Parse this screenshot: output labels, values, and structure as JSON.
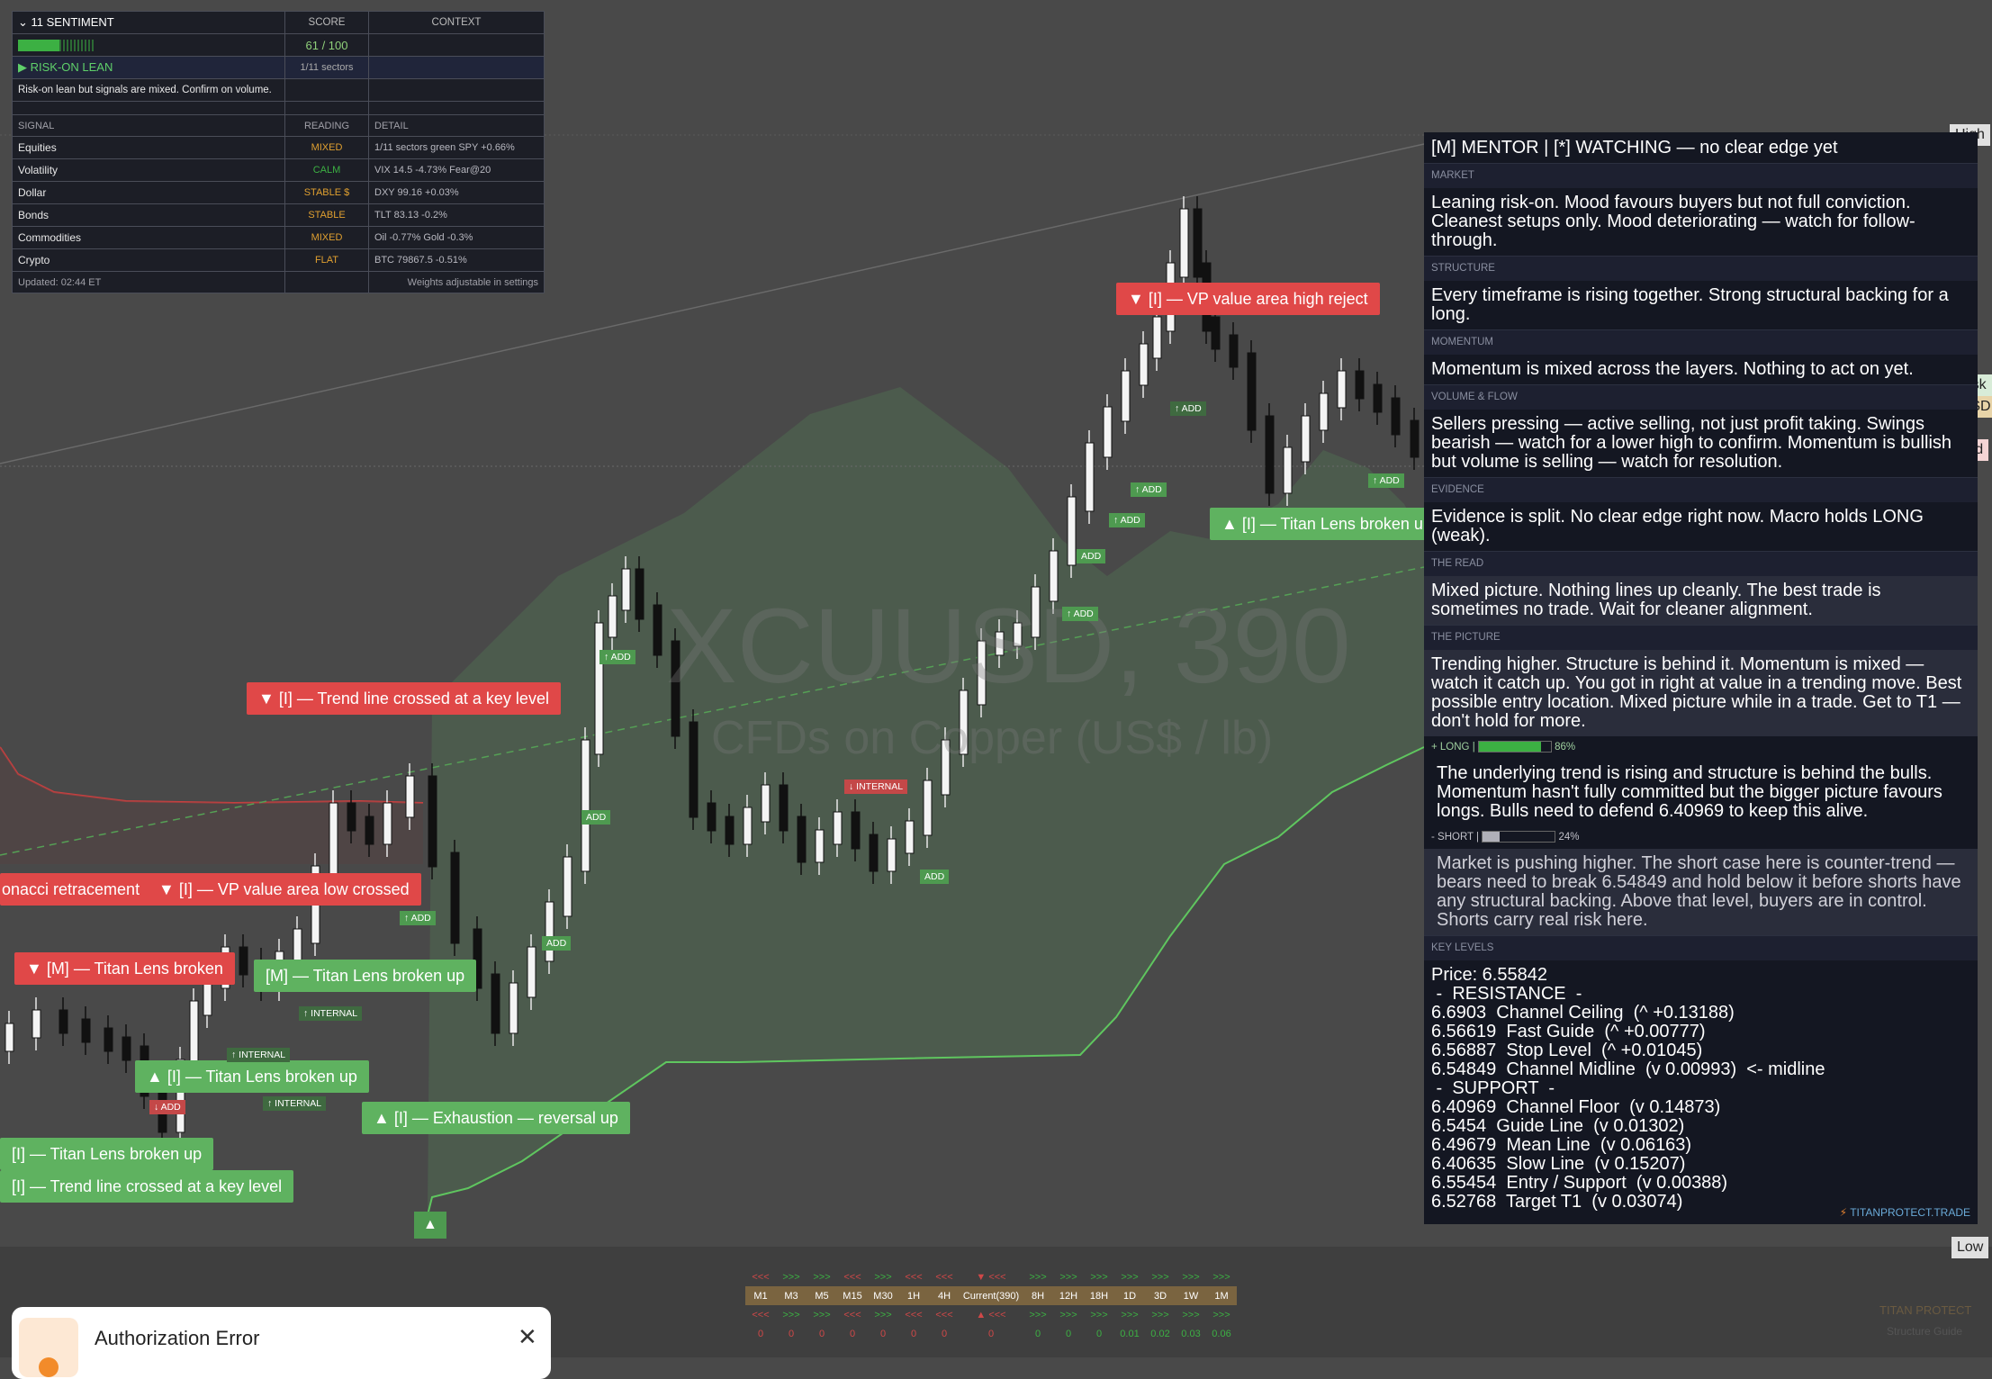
{
  "sentiment": {
    "badge": "11",
    "title": "SENTIMENT",
    "score_header": "SCORE",
    "context_header": "CONTEXT",
    "score": "61 / 100",
    "score_pct": 61,
    "lean": "▶ RISK-ON LEAN",
    "lean_sectors": "1/11 sectors",
    "note": "Risk-on lean but signals are mixed. Confirm on volume.",
    "signal_header": "SIGNAL",
    "reading_header": "READING",
    "detail_header": "DETAIL",
    "rows": [
      {
        "signal": "Equities",
        "reading": "MIXED",
        "detail": "1/11 sectors green  SPY +0.66%",
        "color": "#e0a030"
      },
      {
        "signal": "Volatility",
        "reading": "CALM",
        "detail": "VIX 14.5  -4.73%  Fear@20",
        "color": "#3cb043"
      },
      {
        "signal": "Dollar",
        "reading": "STABLE $",
        "detail": "DXY 99.16  +0.03%",
        "color": "#e0a030"
      },
      {
        "signal": "Bonds",
        "reading": "STABLE",
        "detail": "TLT 83.13  -0.2%",
        "color": "#e0a030"
      },
      {
        "signal": "Commodities",
        "reading": "MIXED",
        "detail": "Oil -0.77%  Gold -0.3%",
        "color": "#e0a030"
      },
      {
        "signal": "Crypto",
        "reading": "FLAT",
        "detail": "BTC 79867.5  -0.51%",
        "color": "#e0a030"
      }
    ],
    "updated": "Updated: 02:44 ET",
    "weights": "Weights adjustable in settings"
  },
  "mentor": {
    "title": "[M]  MENTOR  |  [*]  WATCHING  —  no clear edge yet",
    "market_label": "MARKET",
    "market": "Leaning risk-on. Mood favours buyers but not full conviction. Cleanest setups only. Mood deteriorating — watch for follow-through.",
    "structure_label": "STRUCTURE",
    "structure": "Every timeframe is rising together. Strong structural backing for a long.",
    "momentum_label": "MOMENTUM",
    "momentum": "Momentum is mixed across the layers. Nothing to act on yet.",
    "volume_label": "VOLUME & FLOW",
    "volume": "Sellers pressing — active selling, not just profit taking. Swings bearish — watch for a lower high to confirm. Momentum is bullish but volume is selling — watch for resolution.",
    "evidence_label": "EVIDENCE",
    "evidence": "Evidence is split. No clear edge right now. Macro holds LONG (weak).",
    "read_label": "THE READ",
    "read": "Mixed picture. Nothing lines up cleanly. The best trade is sometimes no trade. Wait for cleaner alignment.",
    "picture_label": "THE PICTURE",
    "picture": "Trending higher. Structure is behind it. Momentum is mixed — watch it catch up. You got in right at value in a trending move. Best possible entry location. Mixed picture while in a trade. Get to T1 — don't hold for more.",
    "long_label": "+ LONG  |",
    "long_pct": "86%",
    "long_value": 86,
    "long_text": "The underlying trend is rising and structure is behind the bulls. Momentum hasn't fully committed but the bigger picture favours longs. Bulls need to defend 6.40969 to keep this alive.",
    "short_label": "- SHORT  |",
    "short_pct": "24%",
    "short_value": 24,
    "short_text": "Market is pushing higher. The short case here is counter-trend — bears need to break 6.54849 and hold below it before shorts have any structural backing. Above that level, buyers are in control. Shorts carry real risk here.",
    "levels_label": "KEY LEVELS",
    "levels": [
      "Price: 6.55842",
      " -  RESISTANCE  -",
      "6.6903  Channel Ceiling  (^ +0.13188)",
      "6.56619  Fast Guide  (^ +0.00777)",
      "6.56887  Stop Level  (^ +0.01045)",
      "6.54849  Channel Midline  (v 0.00993)  <- midline",
      " -  SUPPORT  -",
      "6.40969  Channel Floor  (v 0.14873)",
      "6.5454  Guide Line  (v 0.01302)",
      "6.49679  Mean Line  (v 0.06163)",
      "6.40635  Slow Line  (v 0.15207)",
      "6.55454  Entry / Support  (v 0.00388)",
      "6.52768  Target T1  (v 0.03074)"
    ],
    "brand": "TITANPROTECT.TRADE"
  },
  "chart": {
    "symbol_watermark": "XCUUSD, 390",
    "name_watermark": "CFDs on Copper (US$ / lb)",
    "high": "High",
    "low": "Low",
    "ask": "Ask",
    "bid": "Bid",
    "symbol_tag": "XCUUSD",
    "labels": [
      {
        "text": "▼ [I] — VP value area high reject",
        "color": "r"
      },
      {
        "text": "▲ [I] — Titan Lens broken up",
        "color": "g"
      },
      {
        "text": "▼ [I] — Trend line crossed at a key level",
        "color": "r"
      },
      {
        "text": "onacci retracement",
        "color": "r"
      },
      {
        "text": "▼ [I] — VP value area low crossed",
        "color": "r"
      },
      {
        "text": "▼ [M] — Titan Lens broken",
        "color": "r"
      },
      {
        "text": "[M] — Titan Lens broken up",
        "color": "g"
      },
      {
        "text": "▲ [I] — Titan Lens broken up",
        "color": "g"
      },
      {
        "text": "▲ [I] — Exhaustion — reversal up",
        "color": "g"
      },
      {
        "text": "[I] — Titan Lens broken up",
        "color": "g"
      },
      {
        "text": "[I] — Trend line crossed at a key level",
        "color": "g"
      }
    ],
    "minis": {
      "add": "↑ ADD",
      "add2": "ADD",
      "add_down": "↓ ADD",
      "internal_up": "↑ INTERNAL",
      "internal_down": "↓ INTERNAL"
    }
  },
  "timeframes": {
    "frames": [
      "M1",
      "M3",
      "M5",
      "M15",
      "M30",
      "1H",
      "4H",
      "Current(390)",
      "8H",
      "12H",
      "18H",
      "1D",
      "3D",
      "1W",
      "1M"
    ],
    "top": [
      "<<<",
      ">>>",
      ">>>",
      "<<<",
      ">>>",
      "<<<",
      "<<<",
      "▼ <<<",
      ">>>",
      ">>>",
      ">>>",
      ">>>",
      ">>>",
      ">>>",
      ">>>"
    ],
    "bottom": [
      "<<<",
      ">>>",
      ">>>",
      "<<<",
      ">>>",
      "<<<",
      "<<<",
      "▲ <<<",
      ">>>",
      ">>>",
      ">>>",
      ">>>",
      ">>>",
      ">>>",
      ">>>"
    ],
    "values": [
      "0",
      "0",
      "0",
      "0",
      "0",
      "0",
      "0",
      "0",
      "0",
      "0",
      "0",
      "0.01",
      "0.02",
      "0.03",
      "0.06"
    ]
  },
  "auth": {
    "title": "Authorization Error",
    "close": "✕"
  },
  "footer": {
    "brand": "TITAN PROTECT",
    "sub": "Structure Guide"
  }
}
